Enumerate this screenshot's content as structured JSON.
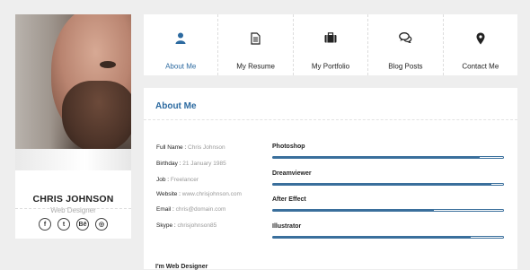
{
  "profile": {
    "name": "CHRIS JOHNSON",
    "role": "Web Designer"
  },
  "socials": [
    {
      "icon": "facebook-icon",
      "glyph": "f"
    },
    {
      "icon": "twitter-icon",
      "glyph": "t"
    },
    {
      "icon": "behance-icon",
      "glyph": "Bē"
    },
    {
      "icon": "dribbble-icon",
      "glyph": "◎"
    }
  ],
  "nav": {
    "items": [
      {
        "label": "About Me",
        "icon": "user-icon",
        "active": true
      },
      {
        "label": "My Resume",
        "icon": "document-icon",
        "active": false
      },
      {
        "label": "My Portfolio",
        "icon": "briefcase-icon",
        "active": false
      },
      {
        "label": "Blog Posts",
        "icon": "comments-icon",
        "active": false
      },
      {
        "label": "Contact Me",
        "icon": "map-marker-icon",
        "active": false
      }
    ]
  },
  "about": {
    "title": "About Me",
    "fields": [
      {
        "label": "Full Name : ",
        "value": "Chris Johnson"
      },
      {
        "label": "Birthday : ",
        "value": "21 January 1985"
      },
      {
        "label": "Job : ",
        "value": "Freelancer"
      },
      {
        "label": "Website : ",
        "value": "www.chrisjohnson.com"
      },
      {
        "label": "Email : ",
        "value": "chris@domain.com"
      },
      {
        "label": "Skype : ",
        "value": "chrisjohnson85"
      }
    ],
    "skills": [
      {
        "name": "Photoshop",
        "level": 0.9
      },
      {
        "name": "Dreamviewer",
        "level": 0.95
      },
      {
        "name": "After Effect",
        "level": 0.7
      },
      {
        "name": "Illustrator",
        "level": 0.86
      }
    ],
    "sub_heading": "I'm Web Designer"
  },
  "colors": {
    "accent": "#2c6aa0",
    "bar": "#3a6f9c"
  }
}
